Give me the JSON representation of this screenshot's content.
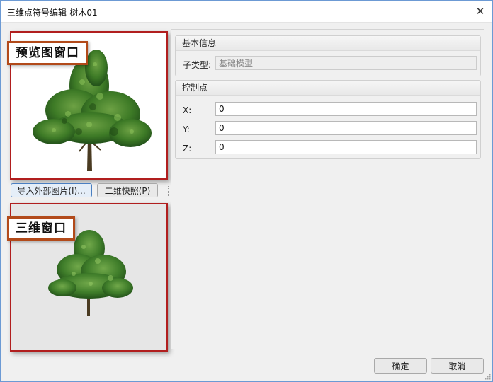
{
  "window": {
    "title": "三维点符号编辑-树木01",
    "close_glyph": "✕"
  },
  "preview": {
    "callout": "预览图窗口"
  },
  "three_d": {
    "callout": "三维窗口"
  },
  "buttons": {
    "import_image": "导入外部图片(I)...",
    "snapshot": "二维快照(P)",
    "ok": "确定",
    "cancel": "取消"
  },
  "basic_info": {
    "title": "基本信息",
    "subtype_label": "子类型:",
    "subtype_value": "基础模型"
  },
  "control_point": {
    "title": "控制点",
    "x_label": "X:",
    "x_value": "0",
    "y_label": "Y:",
    "y_value": "0",
    "z_label": "Z:",
    "z_value": "0"
  },
  "colors": {
    "frame_highlight": "#b11e1e",
    "callout_border": "#b24a1a",
    "tree_green": "#3f7d2a"
  },
  "icons": {
    "close": "close-icon",
    "preview_image": "tree-image",
    "three_d_image": "tree-3d-model",
    "resize": "resize-grip-icon"
  }
}
